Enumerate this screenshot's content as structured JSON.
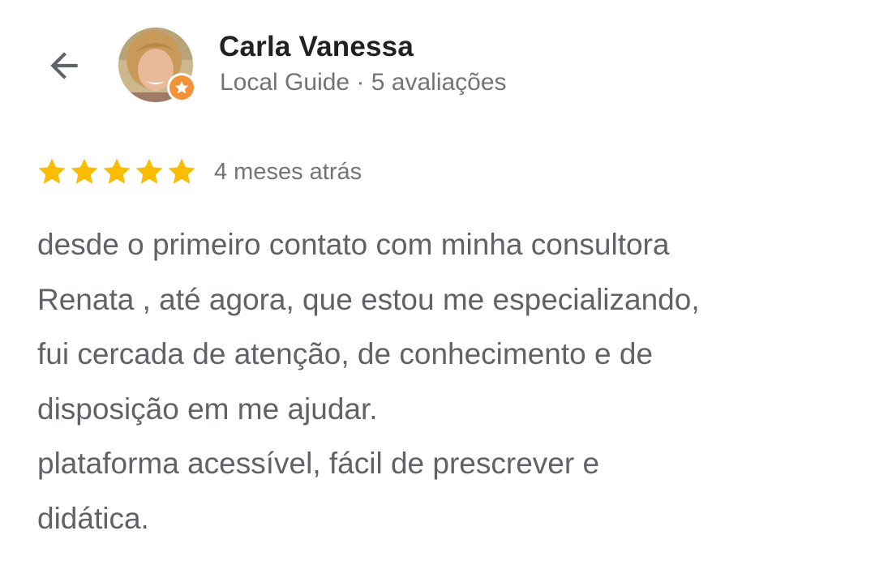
{
  "header": {
    "back_icon": "arrow-back-icon",
    "user_name": "Carla Vanessa",
    "user_meta": "Local Guide · 5 avaliações",
    "badge_icon": "local-guide-star-icon",
    "badge_color": "#f29338"
  },
  "review": {
    "rating": 5,
    "rating_max": 5,
    "star_color": "#fbbc04",
    "date": "4 meses atrás",
    "text": "desde o primeiro contato com minha consultora\nRenata , até agora, que estou me especializando,\nfui cercada de atenção, de conhecimento e de\ndisposição em me ajudar.\nplataforma acessível, fácil de prescrever e\ndidática."
  }
}
